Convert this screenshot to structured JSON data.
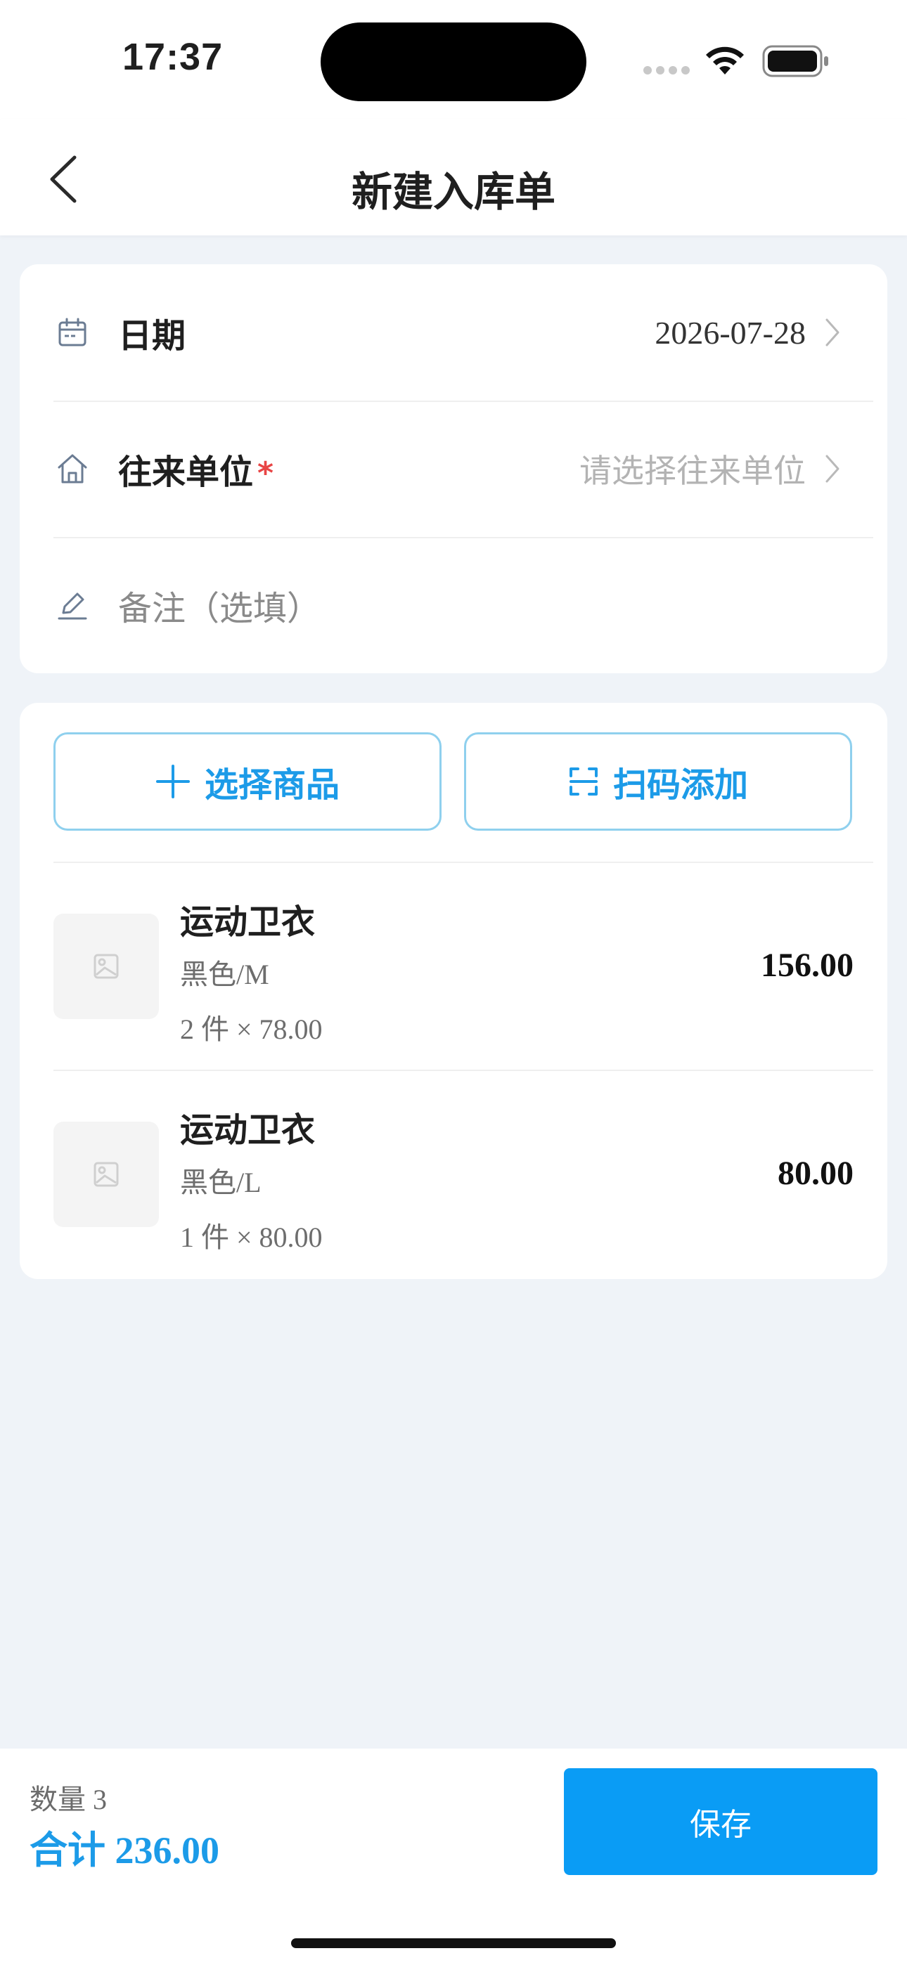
{
  "status_bar": {
    "time": "17:37"
  },
  "nav": {
    "title": "新建入库单"
  },
  "form": {
    "date_label": "日期",
    "date_value": "2026-07-28",
    "partner_label": "往来单位",
    "partner_required_mark": "*",
    "partner_placeholder": "请选择往来单位",
    "remark_placeholder": "备注（选填）"
  },
  "actions": {
    "select_goods_label": "选择商品",
    "scan_add_label": "扫码添加"
  },
  "items": [
    {
      "name": "运动卫衣",
      "spec": "黑色/M",
      "qty_price": "2 件 × 78.00",
      "amount": "156.00"
    },
    {
      "name": "运动卫衣",
      "spec": "黑色/L",
      "qty_price": "1 件 × 80.00",
      "amount": "80.00"
    }
  ],
  "footer": {
    "count_text": "数量 3",
    "total_text": "合计 236.00",
    "save_label": "保存"
  },
  "colors": {
    "accent": "#0a9cf5",
    "background": "#eff3f8",
    "required": "#e84545"
  }
}
